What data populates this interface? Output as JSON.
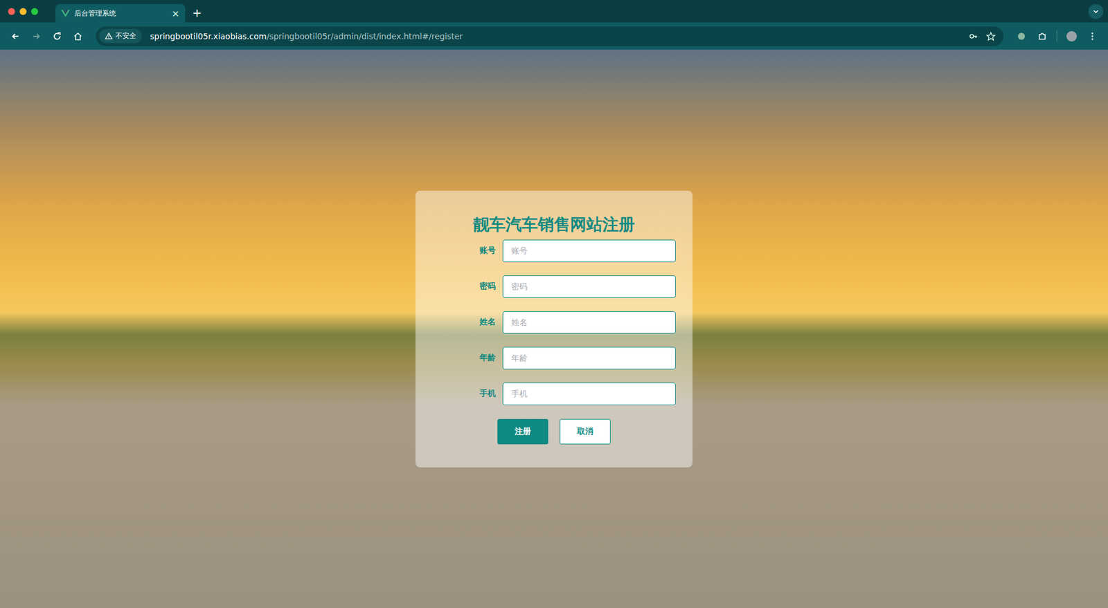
{
  "browser": {
    "tab": {
      "title": "后台管理系统",
      "close": "×",
      "selected": true
    },
    "new_tab": "+",
    "nav": {
      "back_disabled": false,
      "forward_disabled": true
    },
    "security": "不安全",
    "url_host": "springbootil05r.xiaobias.com",
    "url_path": "/springbootil05r/admin/dist/index.html#/register"
  },
  "form": {
    "title": "靓车汽车销售网站注册",
    "fields": [
      {
        "label": "账号",
        "placeholder": "账号"
      },
      {
        "label": "密码",
        "placeholder": "密码"
      },
      {
        "label": "姓名",
        "placeholder": "姓名"
      },
      {
        "label": "年龄",
        "placeholder": "年龄"
      },
      {
        "label": "手机",
        "placeholder": "手机"
      }
    ],
    "buttons": [
      {
        "label": "注册",
        "kind": "primary"
      },
      {
        "label": "取消",
        "kind": "plain"
      }
    ]
  }
}
